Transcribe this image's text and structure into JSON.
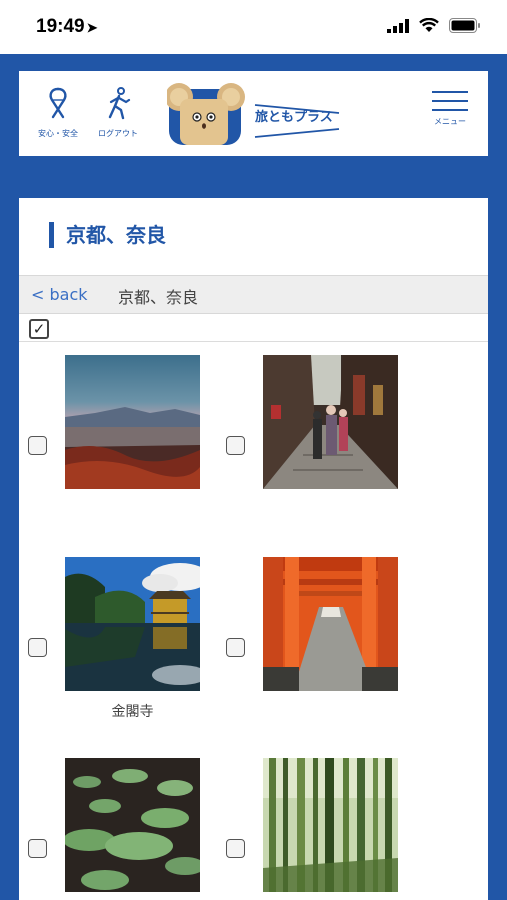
{
  "status_bar": {
    "time": "19:49",
    "location_icon": "location-arrow-icon",
    "signal": "cellular-signal-icon",
    "wifi": "wifi-icon",
    "battery": "battery-icon"
  },
  "header": {
    "safety_label": "安心・安全",
    "logout_label": "ログアウト",
    "logo_text": "旅ともプラス",
    "menu_label": "メニュー"
  },
  "page": {
    "title": "京都、奈良",
    "back_label": "< back",
    "breadcrumb": "京都、奈良"
  },
  "photos": [
    {
      "name": "sunset-city-photo",
      "caption": "",
      "checked": false
    },
    {
      "name": "gion-street-photo",
      "caption": "",
      "checked": false
    },
    {
      "name": "kinkakuji-photo",
      "caption": "金閣寺",
      "checked": false
    },
    {
      "name": "torii-gates-photo",
      "caption": "",
      "checked": false
    },
    {
      "name": "lotus-pond-photo",
      "caption": "",
      "checked": false
    },
    {
      "name": "bamboo-forest-photo",
      "caption": "",
      "checked": false
    }
  ],
  "colors": {
    "brand_blue": "#2156a7",
    "link_blue": "#3a6fc4"
  }
}
